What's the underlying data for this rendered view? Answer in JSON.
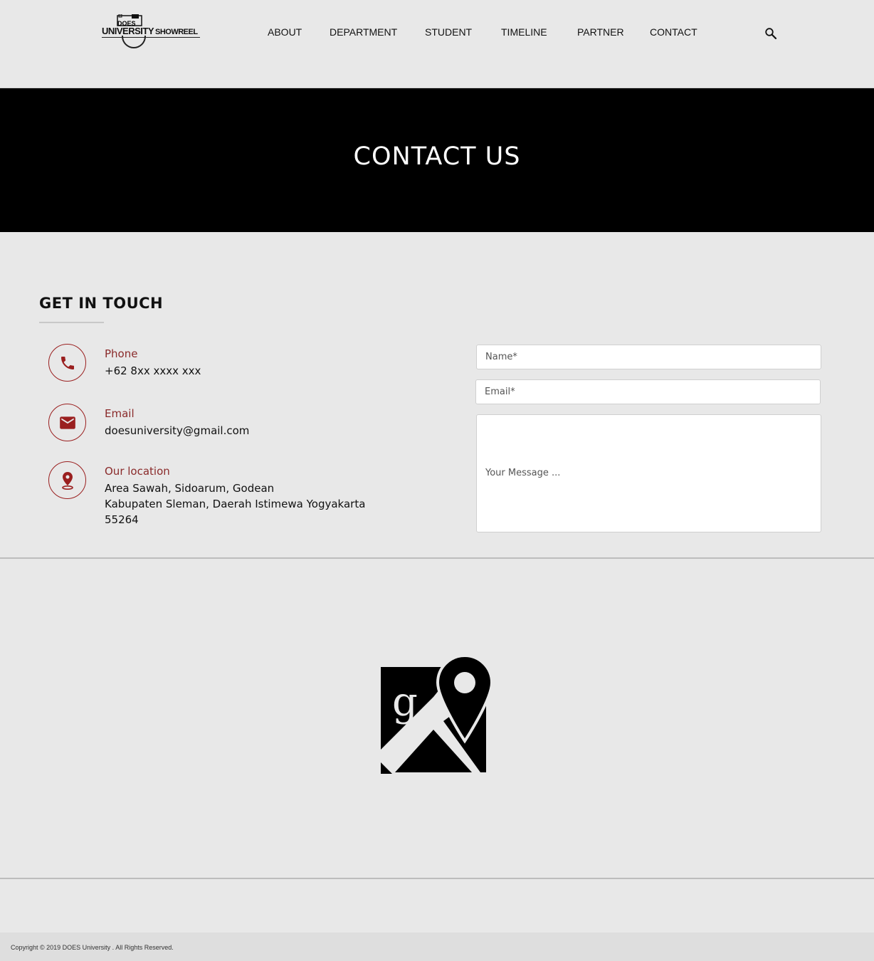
{
  "header": {
    "logo": {
      "main": "UNIVERSITY",
      "top": "DOES",
      "reel": "SHOWREEL"
    },
    "nav": [
      {
        "label": "ABOUT"
      },
      {
        "label": "DEPARTMENT"
      },
      {
        "label": "STUDENT"
      },
      {
        "label": "TIMELINE"
      },
      {
        "label": "PARTNER"
      },
      {
        "label": "CONTACT"
      }
    ],
    "search_icon": "search-icon"
  },
  "hero": {
    "title": "CONTACT US"
  },
  "contact": {
    "heading": "GET IN TOUCH",
    "accent_color": "#9a1f1f",
    "items": [
      {
        "icon": "phone-icon",
        "label": "Phone",
        "lines": [
          "+62 8xx xxxx xxx"
        ]
      },
      {
        "icon": "mail-icon",
        "label": "Email",
        "lines": [
          "doesuniversity@gmail.com"
        ]
      },
      {
        "icon": "location-pin-icon",
        "label": "Our location",
        "lines": [
          "Area Sawah, Sidoarum, Godean",
          "Kabupaten Sleman, Daerah Istimewa Yogyakarta",
          "55264"
        ]
      }
    ],
    "form": {
      "name_placeholder": "Name*",
      "email_placeholder": "Email*",
      "message_placeholder": "Your Message ..."
    }
  },
  "map": {
    "icon": "google-maps-icon"
  },
  "footer": {
    "copyright": "Copyright © 2019 DOES University . All Rights Reserved."
  }
}
